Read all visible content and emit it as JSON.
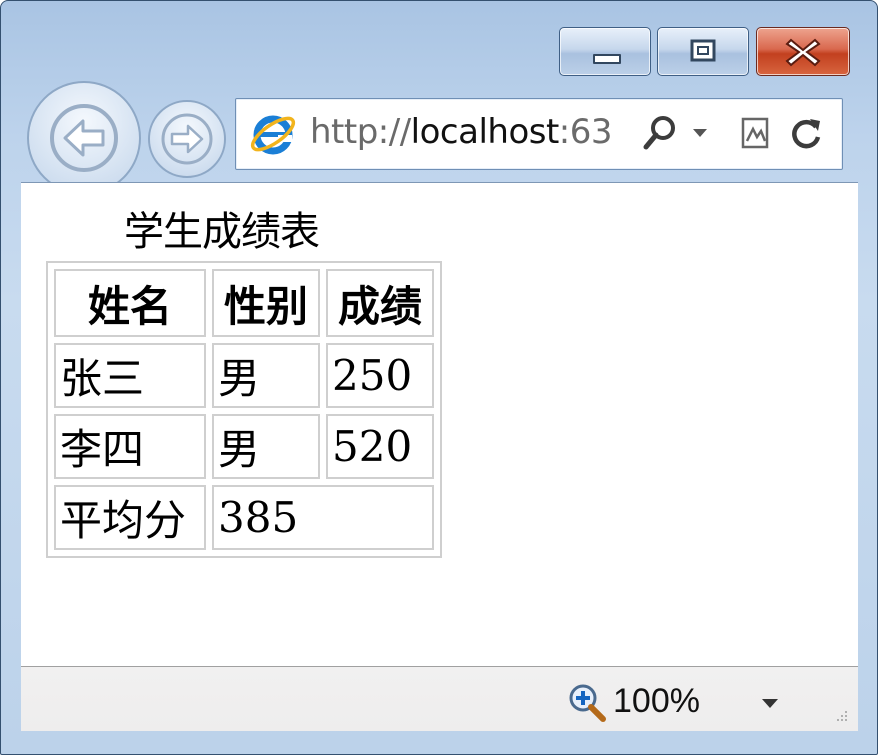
{
  "browser": {
    "address": {
      "url_scheme": "http://",
      "url_host": "localhost",
      "url_port": ":63"
    },
    "status": {
      "zoom": "100%"
    }
  },
  "page": {
    "title": "学生成绩表",
    "table": {
      "headers": [
        "姓名",
        "性别",
        "成绩"
      ],
      "rows": [
        [
          "张三",
          "男",
          "250"
        ],
        [
          "李四",
          "男",
          "520"
        ]
      ],
      "footer": {
        "label": "平均分",
        "value": "385"
      }
    }
  },
  "colors": {
    "window_frame": "#bcd2ea",
    "close_button": "#c2401f",
    "number_text": "#1a1a80",
    "cell_border": "#cfcfcf"
  },
  "icons": [
    "minimize-icon",
    "maximize-icon",
    "close-icon",
    "back-arrow-icon",
    "forward-arrow-icon",
    "ie-logo-icon",
    "search-icon",
    "chevron-down-icon",
    "compatibility-view-icon",
    "refresh-icon",
    "zoom-icon",
    "resize-grip-icon"
  ]
}
